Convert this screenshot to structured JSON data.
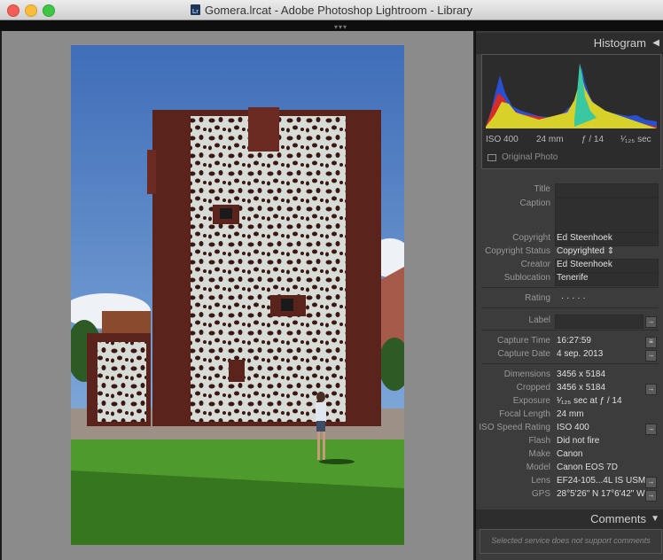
{
  "window": {
    "title": "Gomera.lrcat - Adobe Photoshop Lightroom - Library",
    "app_icon_text": "Lr"
  },
  "histogram": {
    "header": "Histogram",
    "iso": "ISO 400",
    "focal": "24 mm",
    "aperture": "ƒ / 14",
    "shutter": "¹⁄₁₂₅ sec",
    "original_photo_label": "Original Photo"
  },
  "metadata": {
    "title": {
      "label": "Title",
      "value": ""
    },
    "caption": {
      "label": "Caption",
      "value": ""
    },
    "copyright": {
      "label": "Copyright",
      "value": "Ed Steenhoek"
    },
    "copyright_status": {
      "label": "Copyright Status",
      "value": "Copyrighted ⇕"
    },
    "creator": {
      "label": "Creator",
      "value": "Ed Steenhoek"
    },
    "sublocation": {
      "label": "Sublocation",
      "value": "Tenerife"
    },
    "rating": {
      "label": "Rating",
      "value": "·  ·  ·  ·  ·"
    },
    "label": {
      "label": "Label",
      "value": ""
    },
    "capture_time": {
      "label": "Capture Time",
      "value": "16:27:59"
    },
    "capture_date": {
      "label": "Capture Date",
      "value": "4 sep. 2013"
    },
    "dimensions": {
      "label": "Dimensions",
      "value": "3456 x 5184"
    },
    "cropped": {
      "label": "Cropped",
      "value": "3456 x 5184"
    },
    "exposure": {
      "label": "Exposure",
      "value": "¹⁄₁₂₅ sec at ƒ / 14"
    },
    "focal_length": {
      "label": "Focal Length",
      "value": "24 mm"
    },
    "iso_rating": {
      "label": "ISO Speed Rating",
      "value": "ISO 400"
    },
    "flash": {
      "label": "Flash",
      "value": "Did not fire"
    },
    "make": {
      "label": "Make",
      "value": "Canon"
    },
    "model": {
      "label": "Model",
      "value": "Canon EOS 7D"
    },
    "lens": {
      "label": "Lens",
      "value": "EF24-105...4L IS USM"
    },
    "gps": {
      "label": "GPS",
      "value": "28°5'26\" N 17°6'42\" W"
    }
  },
  "comments": {
    "header": "Comments",
    "message": "Selected service does not support comments"
  },
  "buttons": {
    "arrow": "→",
    "list": "≡"
  },
  "colors": {
    "panel_bg": "#3c3c3c",
    "workspace_bg": "#8b8b8b",
    "sky": "#4a78c2",
    "wall": "#d7dcd6",
    "stone": "#5a231c",
    "grass": "#4f9a2c"
  }
}
